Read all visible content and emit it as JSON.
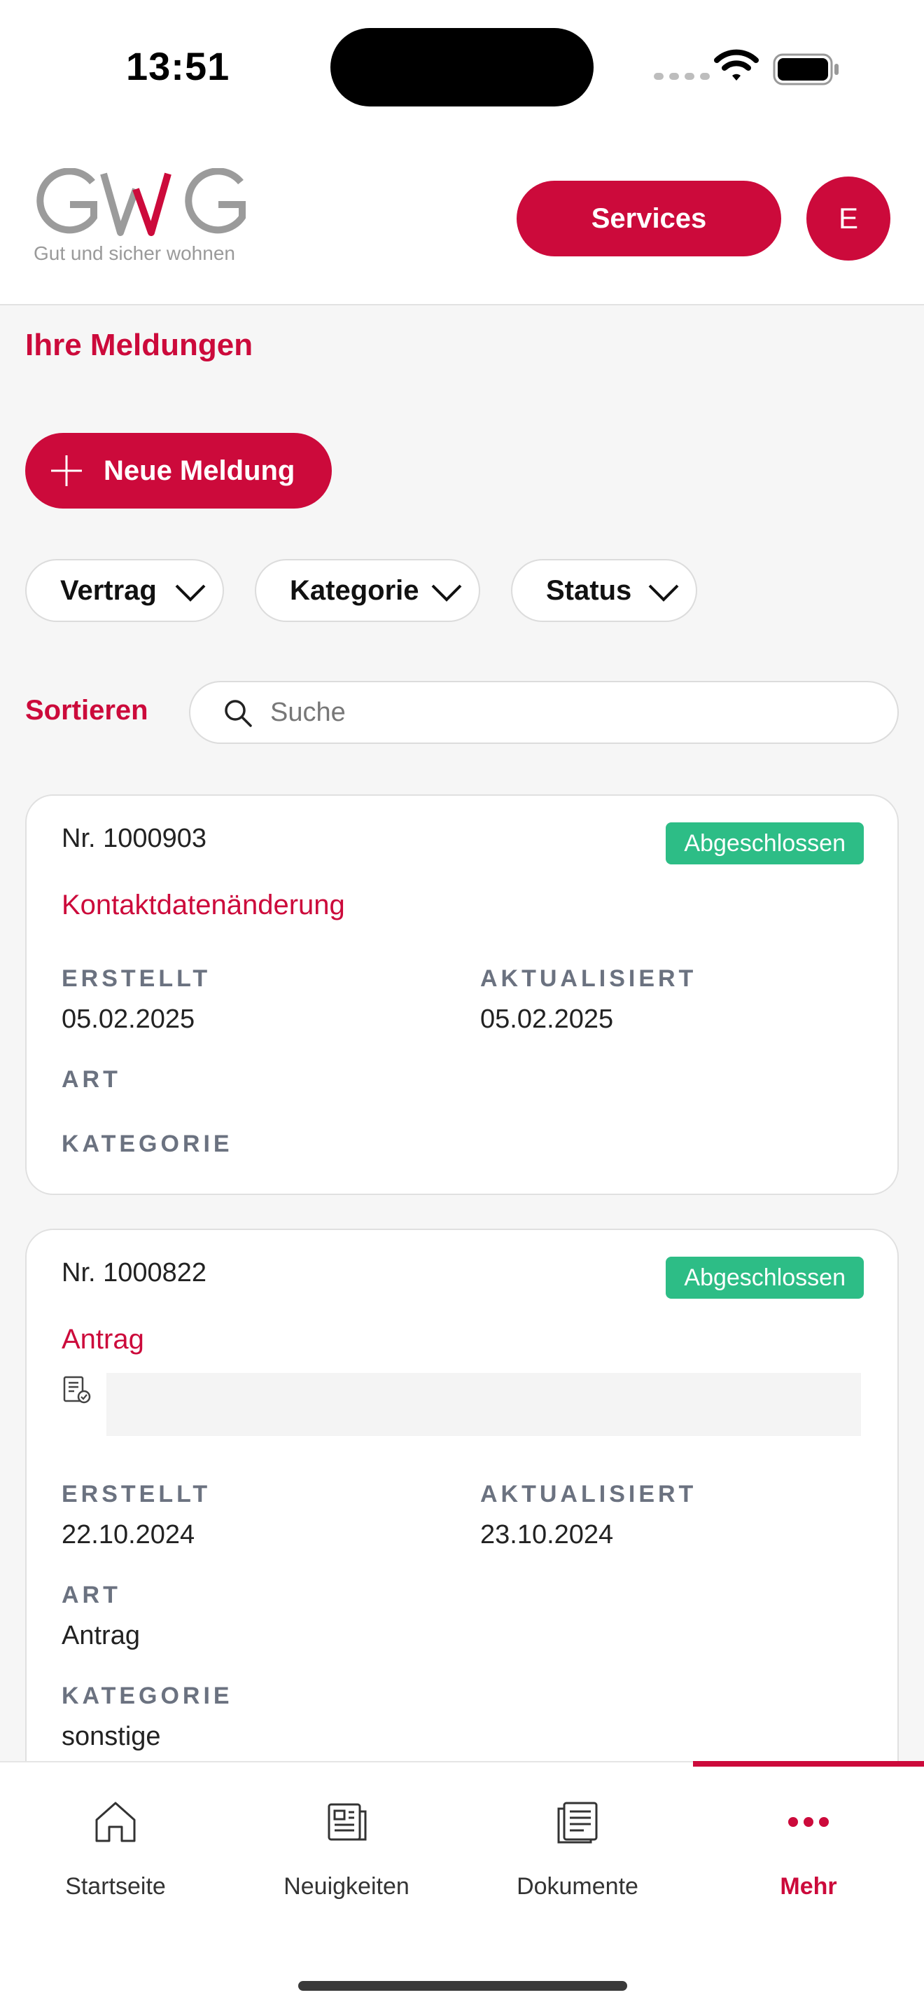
{
  "status_bar": {
    "time": "13:51"
  },
  "header": {
    "logo_text": "GWG",
    "logo_subtitle": "Gut und sicher wohnen",
    "services_label": "Services",
    "avatar_initial": "E",
    "brand_color": "#cc0a3b"
  },
  "page": {
    "title": "Ihre Meldungen",
    "new_button_label": "Neue Meldung"
  },
  "filters": [
    {
      "label": "Vertrag"
    },
    {
      "label": "Kategorie"
    },
    {
      "label": "Status"
    }
  ],
  "sort_label": "Sortieren",
  "search": {
    "placeholder": "Suche",
    "value": ""
  },
  "cards": [
    {
      "nr": "Nr. 1000903",
      "status": "Abgeschlossen",
      "status_color": "#2dbd86",
      "title": "Kontaktdatenänderung",
      "created_label": "ERSTELLT",
      "created": "05.02.2025",
      "updated_label": "AKTUALISIERT",
      "updated": "05.02.2025",
      "art_label": "ART",
      "art": "",
      "kategorie_label": "KATEGORIE",
      "kategorie": ""
    },
    {
      "nr": "Nr. 1000822",
      "status": "Abgeschlossen",
      "status_color": "#2dbd86",
      "title": "Antrag",
      "created_label": "ERSTELLT",
      "created": "22.10.2024",
      "updated_label": "AKTUALISIERT",
      "updated": "23.10.2024",
      "art_label": "ART",
      "art": "Antrag",
      "kategorie_label": "KATEGORIE",
      "kategorie": "sonstige"
    }
  ],
  "tabbar": [
    {
      "label": "Startseite",
      "icon": "home-icon"
    },
    {
      "label": "Neuigkeiten",
      "icon": "newspaper-icon"
    },
    {
      "label": "Dokumente",
      "icon": "document-icon"
    },
    {
      "label": "Mehr",
      "icon": "more-icon",
      "active": true
    }
  ]
}
